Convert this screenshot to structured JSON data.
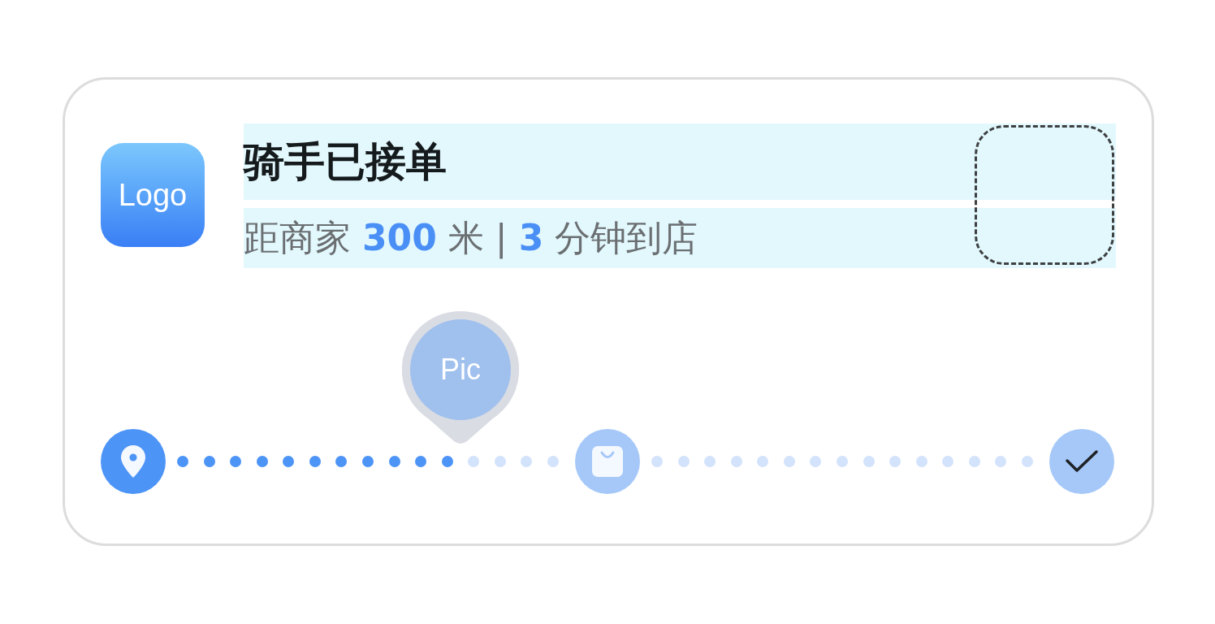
{
  "logo": {
    "label": "Logo"
  },
  "title": "骑手已接单",
  "subtitle": "距商家 **300** 米 | **3** 分钟到店",
  "progress": {
    "steps": [
      {
        "kind": "pin",
        "done": true
      },
      {
        "kind": "bag",
        "done": false
      },
      {
        "kind": "check",
        "done": false
      }
    ],
    "segments": [
      {
        "dots": [
          {
            "filled": true
          },
          {
            "filled": true
          },
          {
            "filled": true
          },
          {
            "filled": true
          },
          {
            "filled": true
          },
          {
            "filled": true
          },
          {
            "filled": true
          },
          {
            "filled": true
          },
          {
            "filled": true
          },
          {
            "filled": true
          },
          {
            "filled": true
          },
          {
            "filled": false
          },
          {
            "filled": false
          },
          {
            "filled": false
          },
          {
            "filled": false
          }
        ]
      },
      {
        "dots": [
          {
            "filled": false
          },
          {
            "filled": false
          },
          {
            "filled": false
          },
          {
            "filled": false
          },
          {
            "filled": false
          },
          {
            "filled": false
          },
          {
            "filled": false
          },
          {
            "filled": false
          },
          {
            "filled": false
          },
          {
            "filled": false
          },
          {
            "filled": false
          },
          {
            "filled": false
          },
          {
            "filled": false
          },
          {
            "filled": false
          },
          {
            "filled": false
          }
        ]
      }
    ],
    "marker": {
      "label": "Pic"
    }
  }
}
